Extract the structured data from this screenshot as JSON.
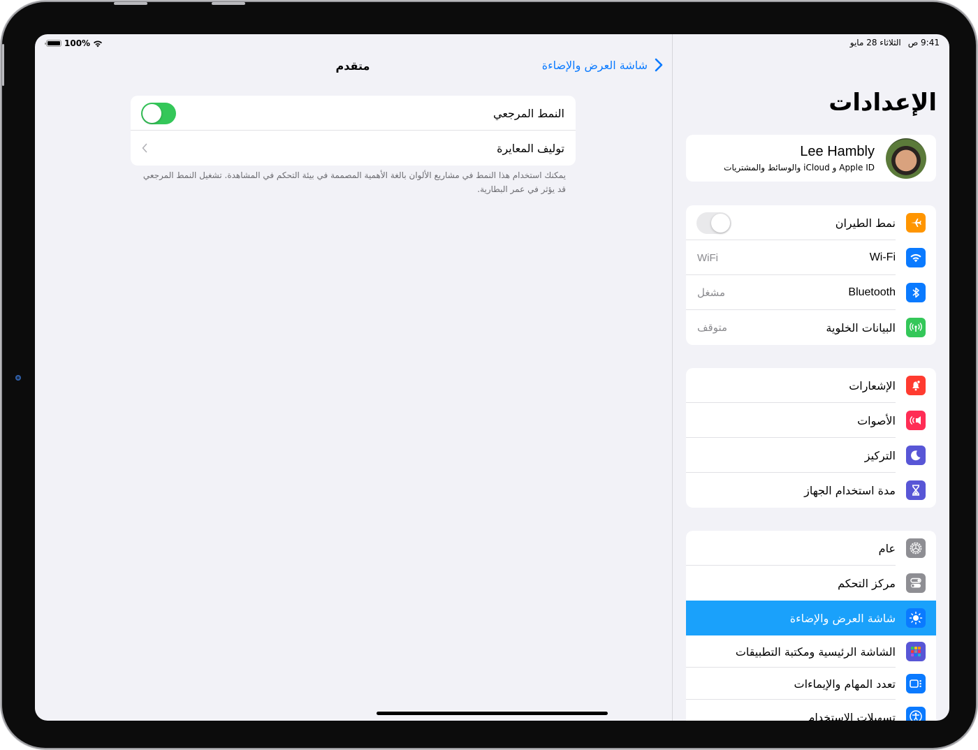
{
  "status_bar": {
    "battery_percent": "100%",
    "time": "9:41 ص",
    "date": "الثلاثاء 28 مايو"
  },
  "detail": {
    "title": "متقدم",
    "back_label": "شاشة العرض والإضاءة",
    "rows": [
      {
        "label": "النمط المرجعي",
        "control": "toggle",
        "on": true
      },
      {
        "label": "توليف المعايرة",
        "control": "chevron"
      }
    ],
    "footnote": "يمكنك استخدام هذا النمط في مشاريع الألوان بالغة الأهمية المصممة في بيئة التحكم في المشاهدة. تشغيل النمط المرجعي قد يؤثر في عمر البطارية."
  },
  "sidebar": {
    "title": "الإعدادات",
    "profile": {
      "name": "Lee Hambly",
      "subtitle": "Apple ID و iCloud والوسائط والمشتريات"
    },
    "group1": [
      {
        "label": "نمط الطيران",
        "icon": "airplane-icon",
        "color": "#ff9500",
        "control": "toggle",
        "on": false
      },
      {
        "label": "Wi-Fi",
        "icon": "wifi-icon",
        "color": "#0a7aff",
        "value": "WiFi"
      },
      {
        "label": "Bluetooth",
        "icon": "bluetooth-icon",
        "color": "#0a7aff",
        "value": "مشغل"
      },
      {
        "label": "البيانات الخلوية",
        "icon": "antenna-icon",
        "color": "#34c759",
        "value": "متوقف"
      }
    ],
    "group2": [
      {
        "label": "الإشعارات",
        "icon": "bell-icon",
        "color": "#ff3b30"
      },
      {
        "label": "الأصوات",
        "icon": "speaker-icon",
        "color": "#ff2d55"
      },
      {
        "label": "التركيز",
        "icon": "moon-icon",
        "color": "#5856d6"
      },
      {
        "label": "مدة استخدام الجهاز",
        "icon": "hourglass-icon",
        "color": "#5856d6"
      }
    ],
    "group3": [
      {
        "label": "عام",
        "icon": "gear-icon",
        "color": "#8e8e93"
      },
      {
        "label": "مركز التحكم",
        "icon": "switches-icon",
        "color": "#8e8e93"
      },
      {
        "label": "شاشة العرض والإضاءة",
        "icon": "sun-icon",
        "color": "#0a7aff",
        "selected": true
      },
      {
        "label": "الشاشة الرئيسية ومكتبة التطبيقات",
        "icon": "app-grid-icon",
        "color": "#5856d6"
      },
      {
        "label": "تعدد المهام والإيماءات",
        "icon": "multitasking-icon",
        "color": "#0a7aff"
      },
      {
        "label": "تسهيلات الاستخدام",
        "icon": "accessibility-icon",
        "color": "#0a7aff"
      }
    ]
  },
  "colors": {
    "accent": "#0a7aff",
    "toggle_on": "#34c759",
    "selected_row": "#1aa1fb",
    "background": "#f2f2f7"
  }
}
